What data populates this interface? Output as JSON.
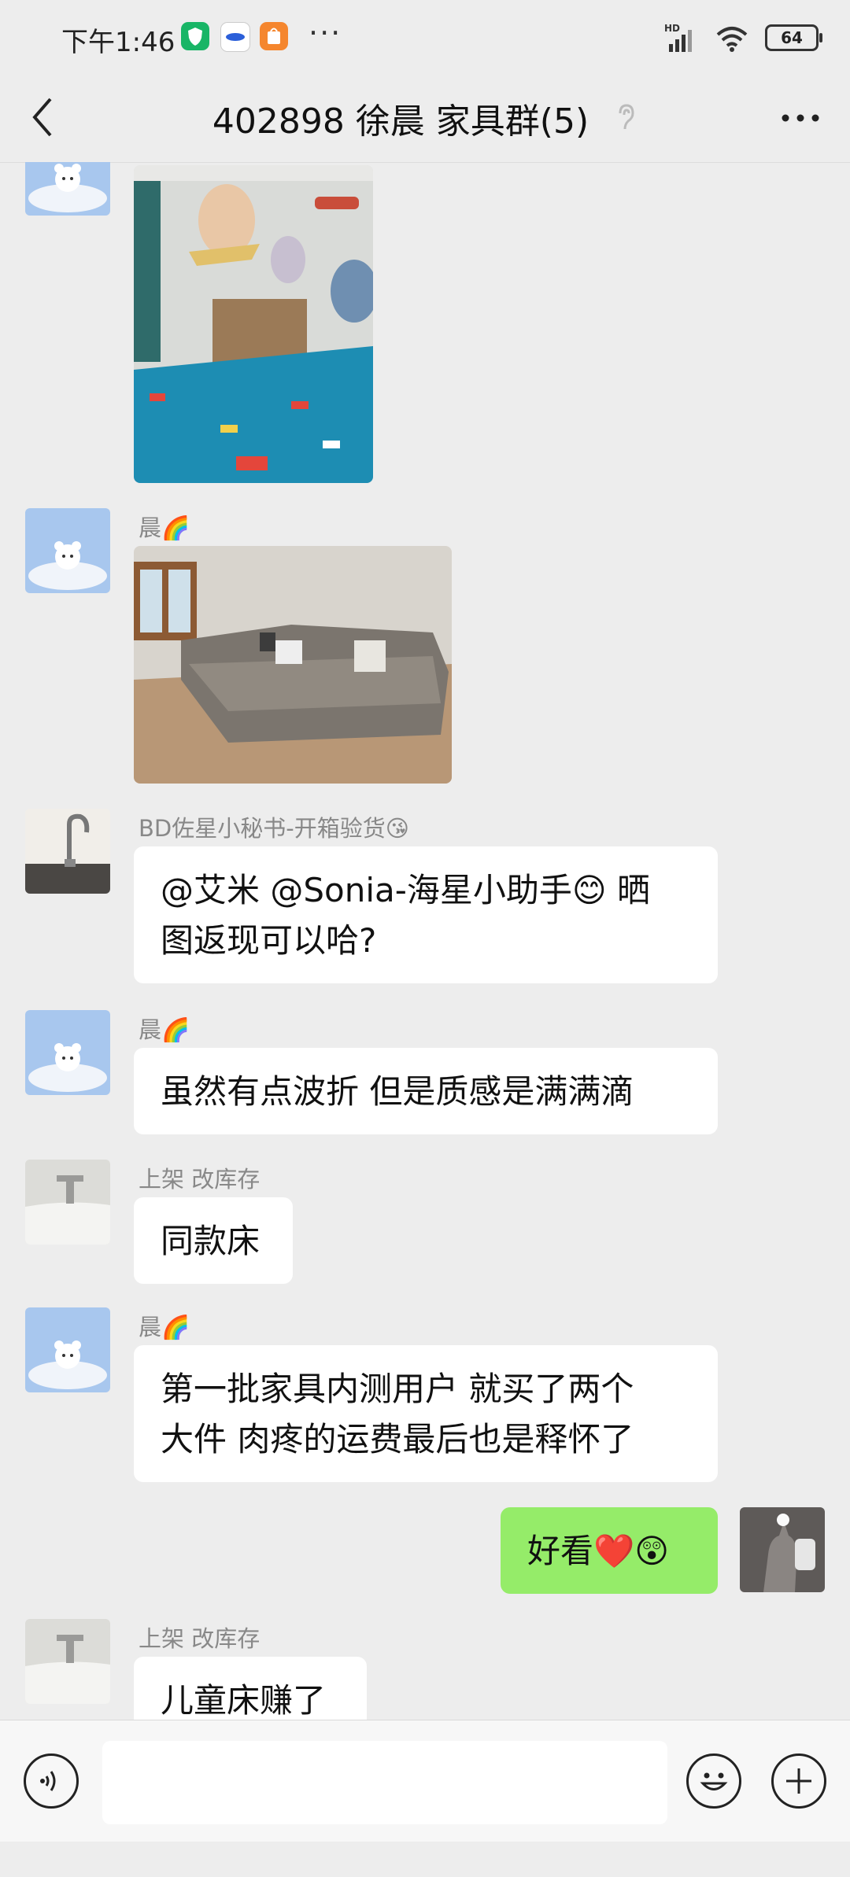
{
  "status_bar": {
    "time": "下午1:46",
    "network_label": "HD",
    "battery": "64"
  },
  "header": {
    "title": "402898 徐晨 家具群(5)",
    "back_icon": "chevron-left-icon",
    "more_icon": "more-dots-icon"
  },
  "messages": [
    {
      "type": "image",
      "sender": "",
      "subject": "children's bedroom with hot-air-balloon mural and blue car blanket"
    },
    {
      "type": "image",
      "sender": "晨🌈",
      "subject": "living room with grey sectional sofa"
    },
    {
      "type": "text",
      "sender": "BD佐星小秘书-开箱验货😘",
      "line1": "@艾米 @Sonia-海星小助手😊 晒",
      "line2": "图返现可以哈?"
    },
    {
      "type": "text",
      "sender": "晨🌈",
      "text": "虽然有点波折 但是质感是满满滴"
    },
    {
      "type": "text",
      "sender": "上架 改库存",
      "text": "同款床"
    },
    {
      "type": "text",
      "sender": "晨🌈",
      "line1": "第一批家具内测用户 就买了两个",
      "line2": "大件 肉疼的运费最后也是释怀了"
    },
    {
      "type": "text",
      "sender": "me",
      "text": "好看❤️😲"
    },
    {
      "type": "text",
      "sender": "上架 改库存",
      "text": "儿童床赚了"
    }
  ],
  "input_bar": {
    "voice_icon": "voice-icon",
    "emoji_icon": "emoji-icon",
    "plus_icon": "plus-icon",
    "placeholder": ""
  }
}
